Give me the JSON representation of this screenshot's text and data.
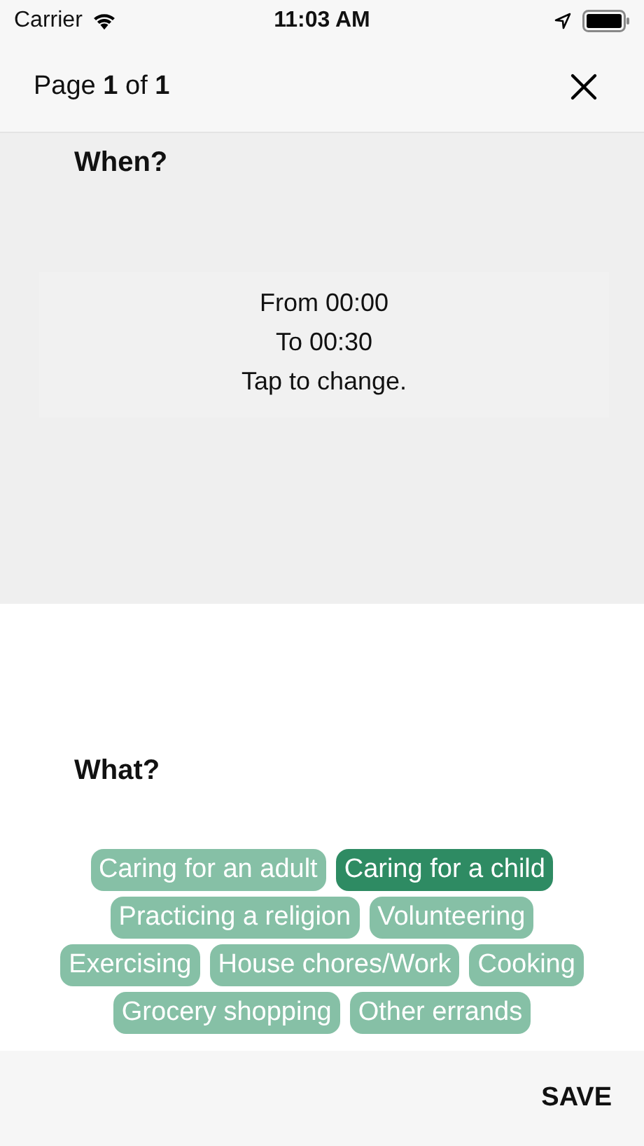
{
  "status_bar": {
    "carrier": "Carrier",
    "time": "11:03 AM"
  },
  "header": {
    "title": "Page **1** of **1**"
  },
  "when": {
    "heading": "When?",
    "lines": [
      "From 00:00",
      "To 00:30",
      "Tap to change."
    ]
  },
  "what": {
    "heading": "What?",
    "tag_rows": [
      [
        {
          "label": "Caring for an adult",
          "selected": false
        },
        {
          "label": "Caring for a child",
          "selected": true
        }
      ],
      [
        {
          "label": "Practicing a religion",
          "selected": false
        },
        {
          "label": "Volunteering",
          "selected": false
        }
      ],
      [
        {
          "label": "Exercising",
          "selected": false
        },
        {
          "label": "House chores/Work",
          "selected": false
        },
        {
          "label": "Cooking",
          "selected": false
        }
      ],
      [
        {
          "label": "Grocery shopping",
          "selected": false
        },
        {
          "label": "Other errands",
          "selected": false
        }
      ]
    ]
  },
  "footer": {
    "button": "SAVE"
  }
}
